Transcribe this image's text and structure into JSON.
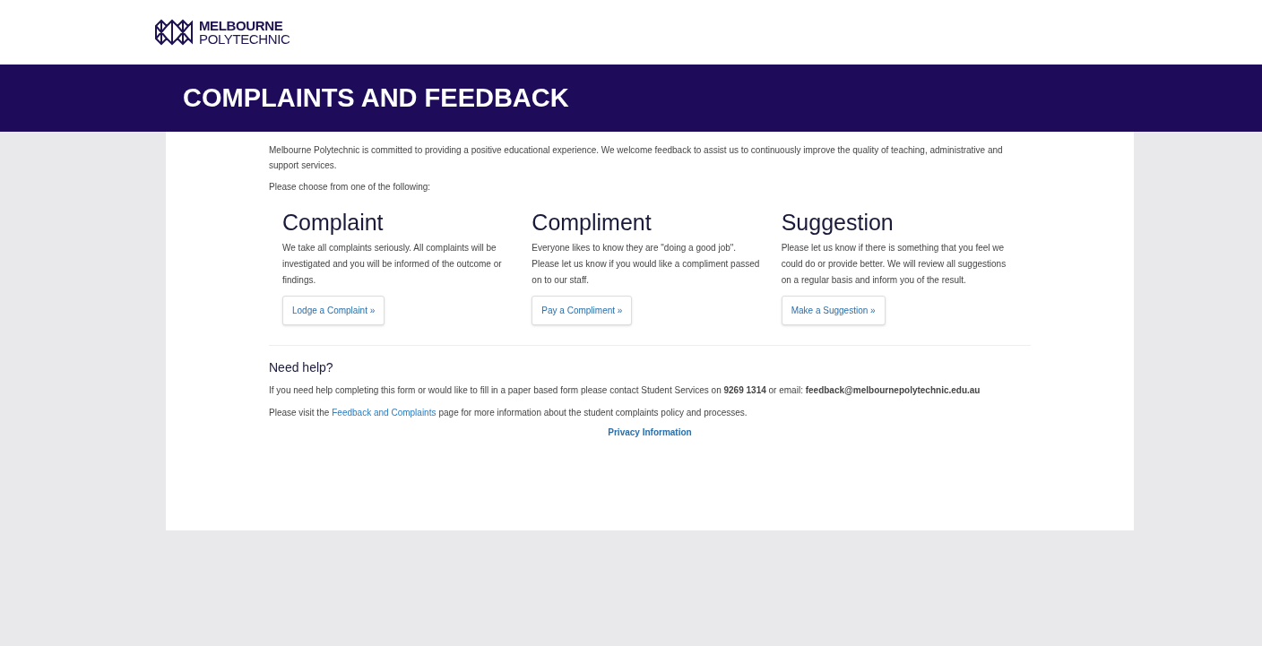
{
  "logo": {
    "line_1": "MELBOURNE",
    "line_2": "POLYTECHNIC"
  },
  "banner": {
    "title": "COMPLAINTS AND FEEDBACK"
  },
  "intro": [
    "Melbourne Polytechnic is committed to providing a positive educational experience. We welcome feedback to assist us to continuously improve the quality of teaching, administrative and support services.",
    "Please choose from one of the following:"
  ],
  "options": [
    {
      "title": "Complaint",
      "text": "We take all complaints seriously. All complaints will be investigated and you will be informed of the outcome or findings.",
      "button": "Lodge a Complaint »"
    },
    {
      "title": "Compliment",
      "text": "Everyone likes to know they are \"doing a good job\". Please let us know if you would like a compliment passed on to our staff.",
      "button": "Pay a Compliment »"
    },
    {
      "title": "Suggestion",
      "text": "Please let us know if there is something that you feel we could do or provide better. We will review all suggestions on a regular basis and inform you of the result.",
      "button": "Make a Suggestion »"
    }
  ],
  "help": {
    "title": "Need help?",
    "text": "If you need help completing this form or would like to fill in a paper based form please contact Student Services on **9269 1314** or email: **feedback@melbournepolytechnic.edu.au**",
    "visit_before": "Please visit the",
    "visit_link": "Feedback and Complaints",
    "visit_after": "page for more information about the student complaints policy and processes.",
    "privacy_link": "Privacy Information"
  }
}
